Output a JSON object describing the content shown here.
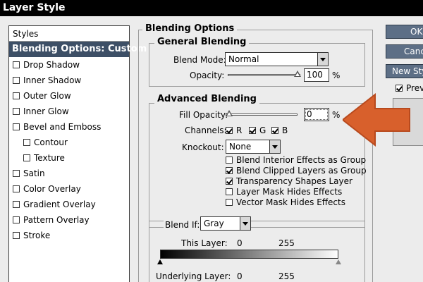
{
  "window": {
    "title": "Layer Style"
  },
  "styles": {
    "header": "Styles",
    "items": [
      {
        "label": "Blending Options: Custom",
        "selected": true,
        "checkbox": false
      },
      {
        "label": "Drop Shadow",
        "checkbox": true
      },
      {
        "label": "Inner Shadow",
        "checkbox": true
      },
      {
        "label": "Outer Glow",
        "checkbox": true
      },
      {
        "label": "Inner Glow",
        "checkbox": true
      },
      {
        "label": "Bevel and Emboss",
        "checkbox": true
      },
      {
        "label": "Contour",
        "checkbox": true,
        "sub": true
      },
      {
        "label": "Texture",
        "checkbox": true,
        "sub": true
      },
      {
        "label": "Satin",
        "checkbox": true
      },
      {
        "label": "Color Overlay",
        "checkbox": true
      },
      {
        "label": "Gradient Overlay",
        "checkbox": true
      },
      {
        "label": "Pattern Overlay",
        "checkbox": true
      },
      {
        "label": "Stroke",
        "checkbox": true
      }
    ]
  },
  "blending_options": {
    "title": "Blending Options",
    "general": {
      "title": "General Blending",
      "blend_mode_label": "Blend Mode:",
      "blend_mode_value": "Normal",
      "opacity_label": "Opacity:",
      "opacity_value": "100",
      "opacity_unit": "%"
    },
    "advanced": {
      "title": "Advanced Blending",
      "fill_opacity_label": "Fill Opacity:",
      "fill_opacity_value": "0",
      "fill_opacity_unit": "%",
      "channels_label": "Channels:",
      "channel_r": "R",
      "channel_g": "G",
      "channel_b": "B",
      "knockout_label": "Knockout:",
      "knockout_value": "None",
      "options": [
        {
          "label": "Blend Interior Effects as Group",
          "checked": false
        },
        {
          "label": "Blend Clipped Layers as Group",
          "checked": true
        },
        {
          "label": "Transparency Shapes Layer",
          "checked": true
        },
        {
          "label": "Layer Mask Hides Effects",
          "checked": false
        },
        {
          "label": "Vector Mask Hides Effects",
          "checked": false
        }
      ]
    },
    "blend_if": {
      "label": "Blend If:",
      "value": "Gray",
      "this_layer_label": "This Layer:",
      "this_layer_min": "0",
      "this_layer_max": "255",
      "underlying_label": "Underlying Layer:",
      "underlying_min": "0",
      "underlying_max": "255"
    }
  },
  "buttons": {
    "ok": "OK",
    "cancel": "Canc",
    "new_style": "New Styl",
    "preview": "Prev"
  },
  "annotation": {
    "arrow_color": "#d8602c"
  },
  "colors": {
    "selection": "#3d4f66",
    "button": "#5d6f86"
  }
}
